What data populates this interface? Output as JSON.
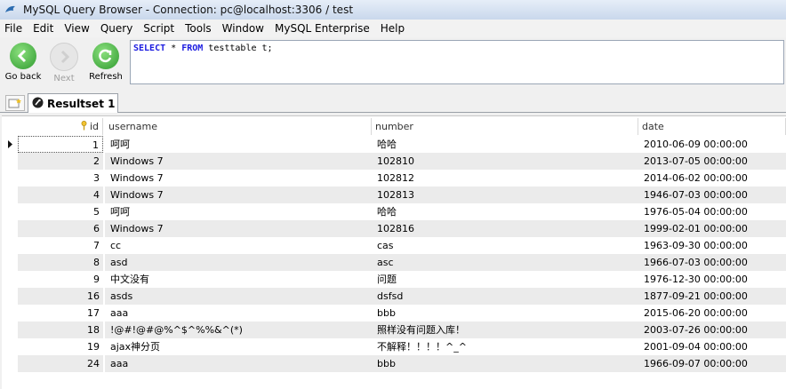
{
  "window": {
    "title": "MySQL Query Browser - Connection: pc@localhost:3306 / test",
    "icon": "dolphin-icon"
  },
  "menu": [
    "File",
    "Edit",
    "View",
    "Query",
    "Script",
    "Tools",
    "Window",
    "MySQL Enterprise",
    "Help"
  ],
  "toolbar": {
    "go_back": "Go back",
    "next": "Next",
    "refresh": "Refresh"
  },
  "query": {
    "kw1": "SELECT",
    "t1": " * ",
    "kw2": "FROM",
    "t2": " testtable t;"
  },
  "tabs": [
    {
      "label": "Resultset 1",
      "icon": "resultset-icon"
    }
  ],
  "colors": {
    "keyword": "#1c1ce0",
    "go_back": "#3aa33a",
    "refresh": "#3aa33a"
  },
  "grid": {
    "columns": [
      "id",
      "username",
      "number",
      "date"
    ],
    "rows": [
      {
        "id": "1",
        "username": "呵呵",
        "number": "哈哈",
        "date": "2010-06-09 00:00:00"
      },
      {
        "id": "2",
        "username": "Windows 7",
        "number": "102810",
        "date": "2013-07-05 00:00:00"
      },
      {
        "id": "3",
        "username": "Windows 7",
        "number": "102812",
        "date": "2014-06-02 00:00:00"
      },
      {
        "id": "4",
        "username": "Windows 7",
        "number": "102813",
        "date": "1946-07-03 00:00:00"
      },
      {
        "id": "5",
        "username": "呵呵",
        "number": "哈哈",
        "date": "1976-05-04 00:00:00"
      },
      {
        "id": "6",
        "username": "Windows 7",
        "number": "102816",
        "date": "1999-02-01 00:00:00"
      },
      {
        "id": "7",
        "username": "cc",
        "number": "cas",
        "date": "1963-09-30 00:00:00"
      },
      {
        "id": "8",
        "username": "asd",
        "number": "asc",
        "date": "1966-07-03 00:00:00"
      },
      {
        "id": "9",
        "username": "中文没有",
        "number": "问题",
        "date": "1976-12-30 00:00:00"
      },
      {
        "id": "16",
        "username": "asds",
        "number": "dsfsd",
        "date": "1877-09-21 00:00:00"
      },
      {
        "id": "17",
        "username": "aaa",
        "number": "bbb",
        "date": "2015-06-20 00:00:00"
      },
      {
        "id": "18",
        "username": "!@#!@#@%^$^%%&^(*)",
        "number": "照样没有问题入库！",
        "date": "2003-07-26 00:00:00"
      },
      {
        "id": "19",
        "username": "ajax神分页",
        "number": "不解释！！！！^_^",
        "date": "2001-09-04 00:00:00"
      },
      {
        "id": "24",
        "username": "aaa",
        "number": "bbb",
        "date": "1966-09-07 00:00:00"
      }
    ]
  }
}
